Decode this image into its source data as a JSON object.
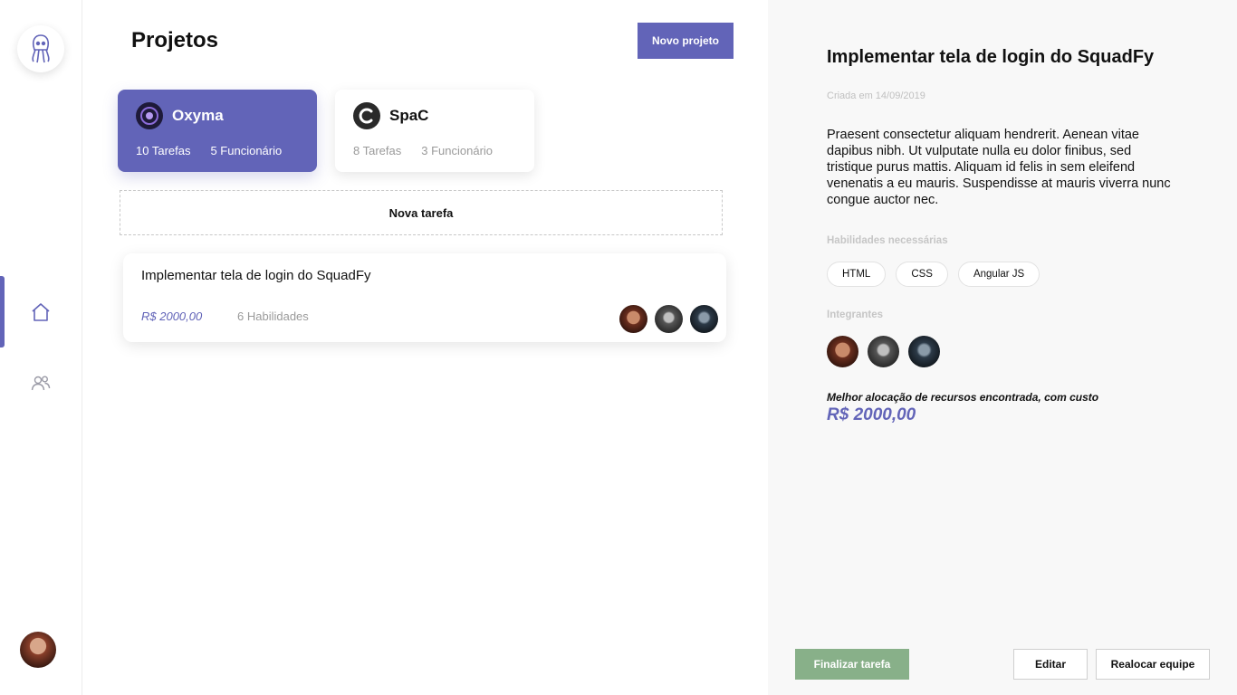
{
  "sidebar": {
    "logo_icon": "squid-logo-icon",
    "nav": [
      {
        "name": "home",
        "icon": "home-icon",
        "active": true
      },
      {
        "name": "team",
        "icon": "users-icon",
        "active": false
      }
    ],
    "user_avatar": "user-avatar"
  },
  "header": {
    "title": "Projetos",
    "new_project_label": "Novo projeto"
  },
  "projects": [
    {
      "name": "Oxyma",
      "tasks": "10 Tarefas",
      "employees": "5 Funcionário",
      "active": true
    },
    {
      "name": "SpaC",
      "tasks": "8 Tarefas",
      "employees": "3 Funcionário",
      "active": false
    }
  ],
  "new_task_label": "Nova tarefa",
  "tasks": [
    {
      "title": "Implementar tela de login do SquadFy",
      "price": "R$ 2000,00",
      "skills": "6 Habilidades"
    }
  ],
  "detail": {
    "title": "Implementar tela de login do SquadFy",
    "created": "Criada em 14/09/2019",
    "description": "Praesent consectetur aliquam hendrerit. Aenean vitae dapibus nibh. Ut vulputate nulla eu dolor finibus, sed tristique purus mattis. Aliquam id felis in sem eleifend venenatis a eu mauris. Suspendisse at mauris viverra nunc congue auctor nec.",
    "skills_label": "Habilidades necessárias",
    "skills": [
      "HTML",
      "CSS",
      "Angular JS"
    ],
    "members_label": "Integrantes",
    "best_allocation_label": "Melhor alocação de recursos encontrada, com custo",
    "best_allocation_value": "R$ 2000,00",
    "finish_label": "Finalizar tarefa",
    "edit_label": "Editar",
    "reassign_label": "Realocar equipe"
  },
  "colors": {
    "accent": "#6264b8",
    "success": "#88b089",
    "panel": "#f8f8f8"
  }
}
